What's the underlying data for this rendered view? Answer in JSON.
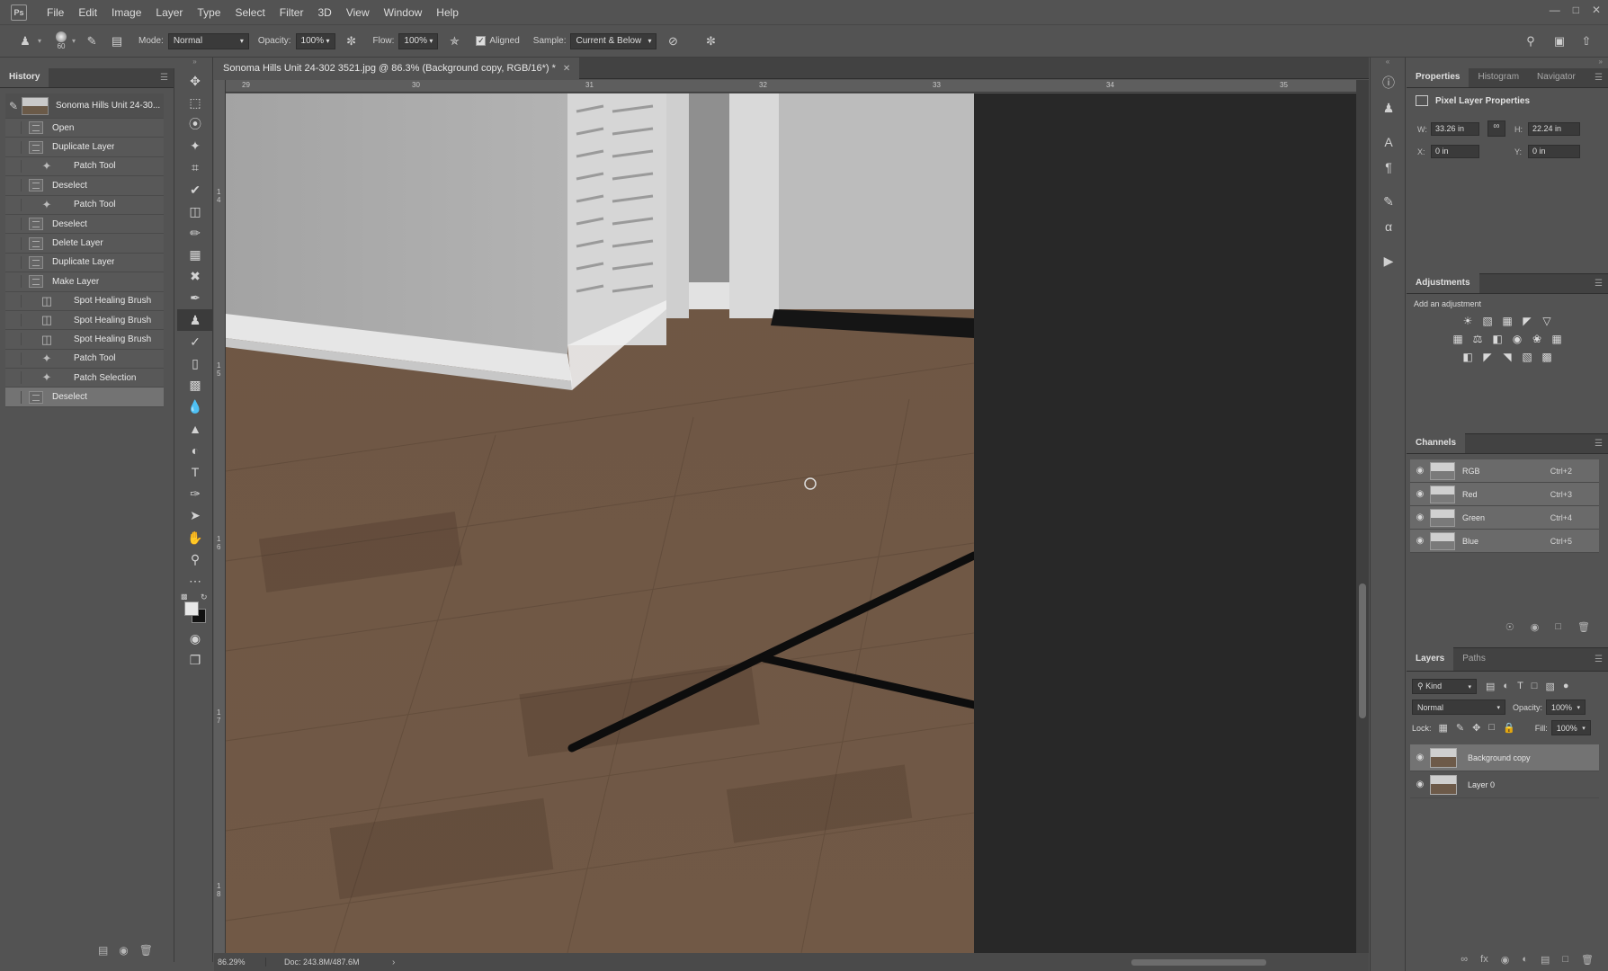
{
  "app": {
    "logo": "Ps"
  },
  "menu": [
    "File",
    "Edit",
    "Image",
    "Layer",
    "Type",
    "Select",
    "Filter",
    "3D",
    "View",
    "Window",
    "Help"
  ],
  "options": {
    "brush_size": "60",
    "mode_label": "Mode:",
    "mode_value": "Normal",
    "opacity_label": "Opacity:",
    "opacity_value": "100%",
    "flow_label": "Flow:",
    "flow_value": "100%",
    "aligned_label": "Aligned",
    "aligned_checked": true,
    "sample_label": "Sample:",
    "sample_value": "Current & Below"
  },
  "history": {
    "title": "History",
    "snapshot": "Sonoma Hills Unit 24-30...",
    "items": [
      {
        "label": "Open",
        "icon": "document-icon"
      },
      {
        "label": "Duplicate Layer",
        "icon": "document-icon"
      },
      {
        "label": "Patch Tool",
        "icon": "patch-tool-icon"
      },
      {
        "label": "Deselect",
        "icon": "document-icon"
      },
      {
        "label": "Patch Tool",
        "icon": "patch-tool-icon"
      },
      {
        "label": "Deselect",
        "icon": "document-icon"
      },
      {
        "label": "Delete Layer",
        "icon": "document-icon"
      },
      {
        "label": "Duplicate Layer",
        "icon": "document-icon"
      },
      {
        "label": "Make Layer",
        "icon": "document-icon"
      },
      {
        "label": "Spot Healing Brush",
        "icon": "spot-healing-icon"
      },
      {
        "label": "Spot Healing Brush",
        "icon": "spot-healing-icon"
      },
      {
        "label": "Spot Healing Brush",
        "icon": "spot-healing-icon"
      },
      {
        "label": "Patch Tool",
        "icon": "patch-tool-icon"
      },
      {
        "label": "Patch Selection",
        "icon": "patch-tool-icon"
      },
      {
        "label": "Deselect",
        "icon": "document-icon"
      }
    ],
    "selected_index": 14
  },
  "document": {
    "tab_title": "Sonoma Hills Unit 24-302 3521.jpg @ 86.3% (Background copy, RGB/16*) *",
    "ruler_top": [
      "29",
      "30",
      "31",
      "32",
      "33",
      "34",
      "35"
    ],
    "ruler_left": [
      "1 4",
      "1 5",
      "1 6",
      "1 7",
      "1 8"
    ],
    "zoom": "86.29%",
    "doc_info": "Doc: 243.8M/487.6M"
  },
  "properties": {
    "tabs": [
      "Properties",
      "Histogram",
      "Navigator"
    ],
    "title": "Pixel Layer Properties",
    "w_label": "W:",
    "w_value": "33.26 in",
    "h_label": "H:",
    "h_value": "22.24 in",
    "x_label": "X:",
    "x_value": "0 in",
    "y_label": "Y:",
    "y_value": "0 in"
  },
  "adjustments": {
    "title": "Adjustments",
    "subtitle": "Add an adjustment"
  },
  "channels": {
    "title": "Channels",
    "rows": [
      {
        "name": "RGB",
        "shortcut": "Ctrl+2"
      },
      {
        "name": "Red",
        "shortcut": "Ctrl+3"
      },
      {
        "name": "Green",
        "shortcut": "Ctrl+4"
      },
      {
        "name": "Blue",
        "shortcut": "Ctrl+5"
      }
    ]
  },
  "layers": {
    "tabs": [
      "Layers",
      "Paths"
    ],
    "kind": "Kind",
    "blend": "Normal",
    "opacity_label": "Opacity:",
    "opacity_value": "100%",
    "lock_label": "Lock:",
    "fill_label": "Fill:",
    "fill_value": "100%",
    "rows": [
      {
        "name": "Background copy",
        "selected": true
      },
      {
        "name": "Layer 0",
        "selected": false
      }
    ]
  },
  "colors": {
    "foreground": "#e8e8e8",
    "background": "#111111"
  }
}
